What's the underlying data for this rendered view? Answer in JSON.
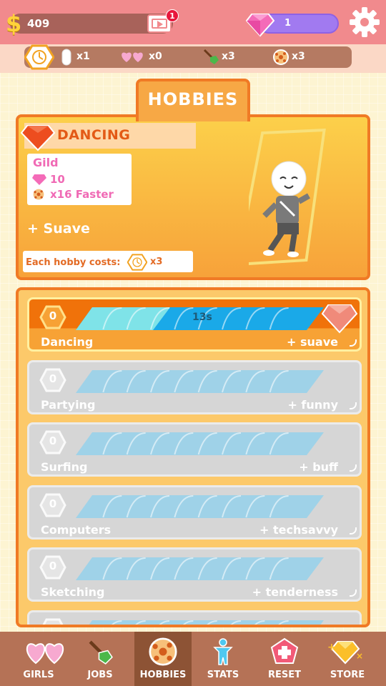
{
  "header": {
    "money": "409",
    "money_symbol": "$",
    "notification_count": "1",
    "gems": "1"
  },
  "status": {
    "items": [
      {
        "icon": "capsule-icon",
        "value": "x1"
      },
      {
        "icon": "hearts-icon",
        "value": "x0"
      },
      {
        "icon": "shovel-icon",
        "value": "x3"
      },
      {
        "icon": "ball-icon",
        "value": "x3"
      }
    ]
  },
  "hobbies_tab": "HOBBIES",
  "hero": {
    "title": "DANCING",
    "gild_title": "Gild",
    "gild_gems": "10",
    "gild_speed": "x16 Faster",
    "trait": "+ Suave",
    "cost_label": "Each hobby costs:",
    "cost_value": "x3"
  },
  "hobbies": [
    {
      "level": "0",
      "name": "Dancing",
      "trait": "+ suave",
      "timer": "13s",
      "progress": 0.33,
      "active": true
    },
    {
      "level": "0",
      "name": "Partying",
      "trait": "+ funny",
      "progress": 0,
      "active": false
    },
    {
      "level": "0",
      "name": "Surfing",
      "trait": "+ buff",
      "progress": 0,
      "active": false
    },
    {
      "level": "0",
      "name": "Computers",
      "trait": "+ techsavvy",
      "progress": 0,
      "active": false
    },
    {
      "level": "0",
      "name": "Sketching",
      "trait": "+ tenderness",
      "progress": 0,
      "active": false
    },
    {
      "level": "0",
      "name": "",
      "trait": "",
      "progress": 0,
      "active": false
    }
  ],
  "nav": {
    "items": [
      {
        "label": "GIRLS",
        "icon": "hearts-icon"
      },
      {
        "label": "JOBS",
        "icon": "shovel-icon"
      },
      {
        "label": "HOBBIES",
        "icon": "ball-icon",
        "active": true
      },
      {
        "label": "STATS",
        "icon": "person-icon"
      },
      {
        "label": "RESET",
        "icon": "reset-icon"
      },
      {
        "label": "STORE",
        "icon": "gem-icon"
      }
    ]
  },
  "colors": {
    "accent": "#f07a25",
    "header": "#f18a8d",
    "gem": "#a17af0",
    "bar_fill": "#1aa9e8",
    "bar_empty": "#9fd2e8"
  }
}
